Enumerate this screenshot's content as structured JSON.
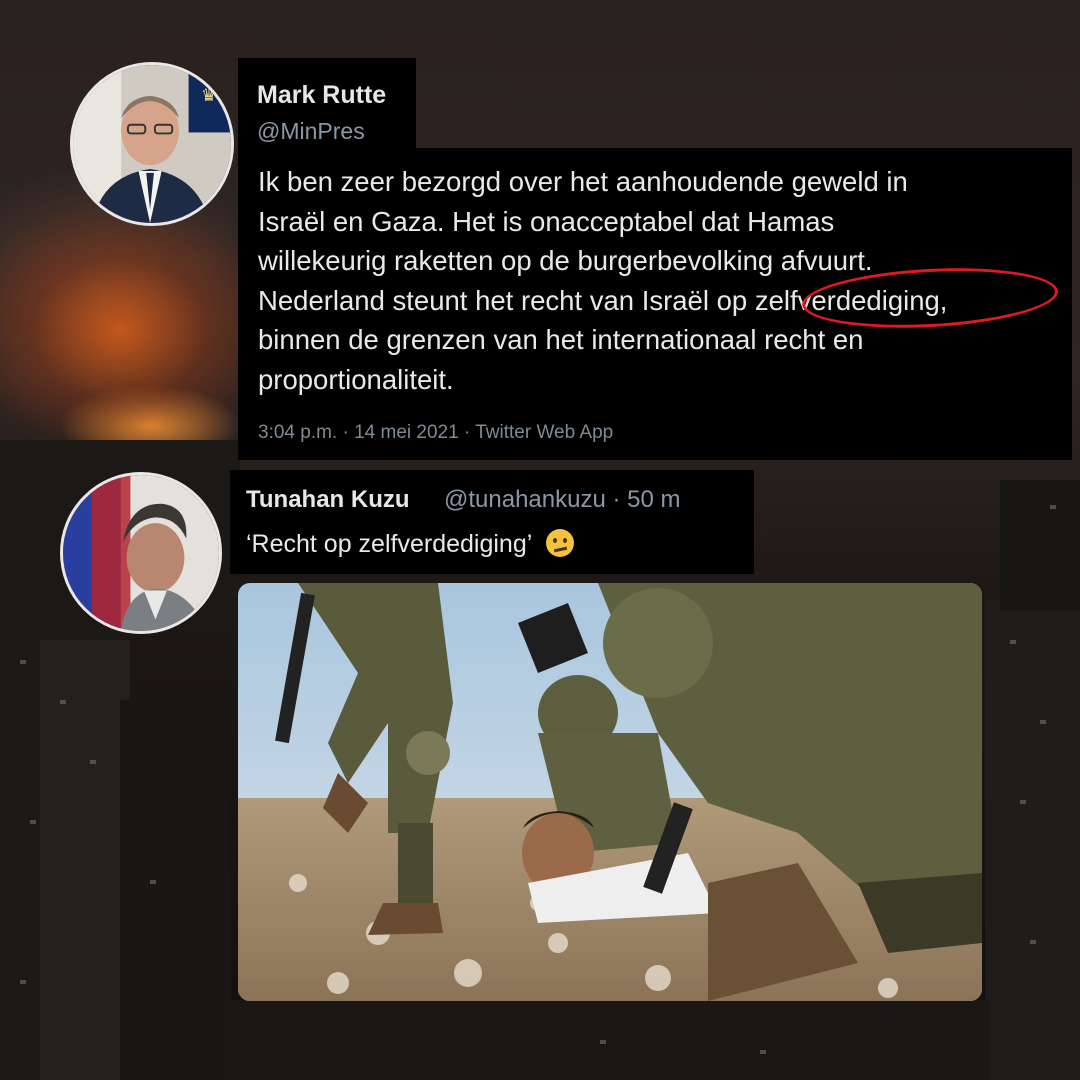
{
  "tweet1": {
    "name": "Mark Rutte",
    "handle": "@MinPres",
    "lines": [
      "Ik ben zeer bezorgd over het aanhoudende geweld in",
      "Israël en Gaza. Het is onacceptabel dat Hamas",
      "willekeurig raketten op de burgerbevolking afvuurt.",
      "Nederland steunt het recht van Israël op zelfverdediging,",
      "binnen de grenzen van het internationaal recht en",
      "proportionaliteit."
    ],
    "highlighted_word": "zelfverdediging,",
    "meta": "3:04 p.m. · 14 mei 2021 · Twitter Web App",
    "avatar_icon": "government-crest-icon"
  },
  "tweet2": {
    "name": "Tunahan Kuzu",
    "handle_time": "@tunahankuzu · 50 m",
    "text": "‘Recht op zelfverdediging’",
    "emoji": "🫤",
    "photo_description_icon": "soldiers-arresting-boy-photo"
  },
  "colors": {
    "highlight_circle": "#e01a22",
    "card_background": "#000000",
    "muted_text": "#8b98a5"
  }
}
